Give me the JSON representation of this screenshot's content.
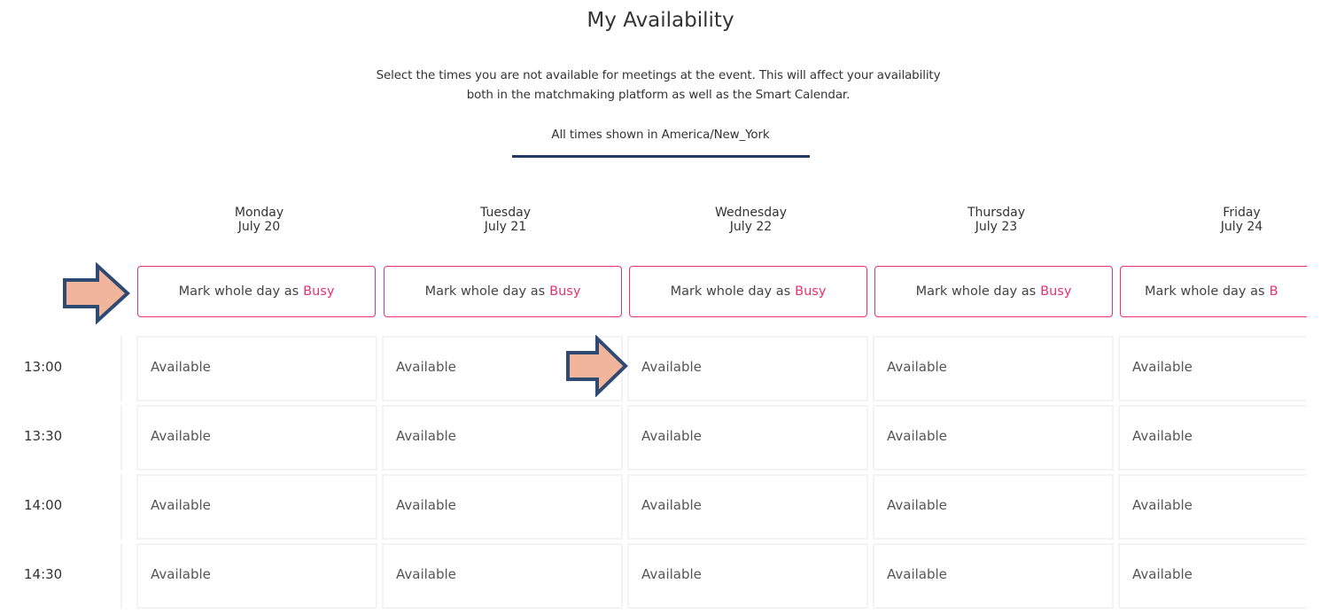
{
  "page": {
    "title": "My Availability",
    "description_line1": "Select the times you are not available for meetings at the event. This will affect your availability",
    "description_line2": "both in the matchmaking platform as well as the Smart Calendar.",
    "timezone_note": "All times shown in America/New_York"
  },
  "mark_busy": {
    "prefix": "Mark whole day as",
    "busy_word": "Busy",
    "busy_word_clipped": "B"
  },
  "days": [
    {
      "weekday": "Monday",
      "date": "July 20"
    },
    {
      "weekday": "Tuesday",
      "date": "July 21"
    },
    {
      "weekday": "Wednesday",
      "date": "July 22"
    },
    {
      "weekday": "Thursday",
      "date": "July 23"
    },
    {
      "weekday": "Friday",
      "date": "July 24"
    }
  ],
  "time_slots": [
    "13:00",
    "13:30",
    "14:00",
    "14:30"
  ],
  "slot_status": "Available",
  "colors": {
    "accent": "#e8336d",
    "arrow_fill": "#f0b59b",
    "arrow_outline": "#2e4a72",
    "underline": "#1f3b64"
  },
  "icons": {
    "annotation_arrow": "right-arrow-icon"
  }
}
